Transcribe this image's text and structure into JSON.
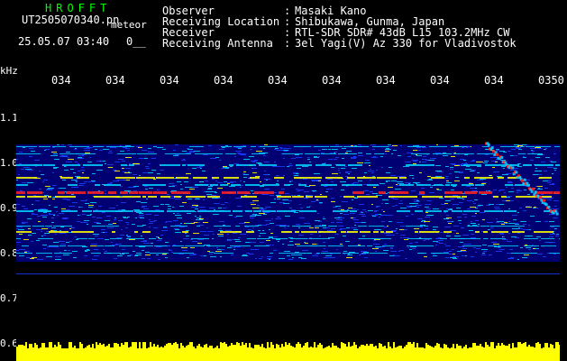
{
  "header": {
    "app_title": "HROFFT",
    "filename": "UT2505070340.pn",
    "meteor_label": "meteor",
    "datetime": "25.05.07 03:40",
    "counter": "0__",
    "info": [
      {
        "key": "Observer",
        "sep": ":",
        "value": "Masaki Kano"
      },
      {
        "key": "Receiving Location",
        "sep": ":",
        "value": "Shibukawa, Gunma, Japan"
      },
      {
        "key": "Receiver",
        "sep": ":",
        "value": "RTL-SDR SDR# 43dB L15 103.2MHz CW"
      },
      {
        "key": "Receiving Antenna",
        "sep": ":",
        "value": "3el Yagi(V) Az 330 for Vladivostok"
      }
    ]
  },
  "axis": {
    "y_unit": "kHz",
    "x_ticks": [
      "034",
      "034",
      "034",
      "034",
      "034",
      "034",
      "034",
      "034",
      "034",
      "0350"
    ],
    "y_ticks": [
      "1.1",
      "1.0",
      "0.9",
      "0.8",
      "0.7",
      "0.6"
    ]
  },
  "colors": {
    "background": "#000000",
    "header_green": "#00ff00",
    "header_white": "#ffffff",
    "spectrum_noise_dark": "#000080",
    "spectrum_noise": "#1a3cff",
    "spectrum_mid": "#00d0ff",
    "spectrum_high": "#ffff00",
    "spectrum_peak": "#ff2020",
    "audio_level": "#ffff00"
  }
}
